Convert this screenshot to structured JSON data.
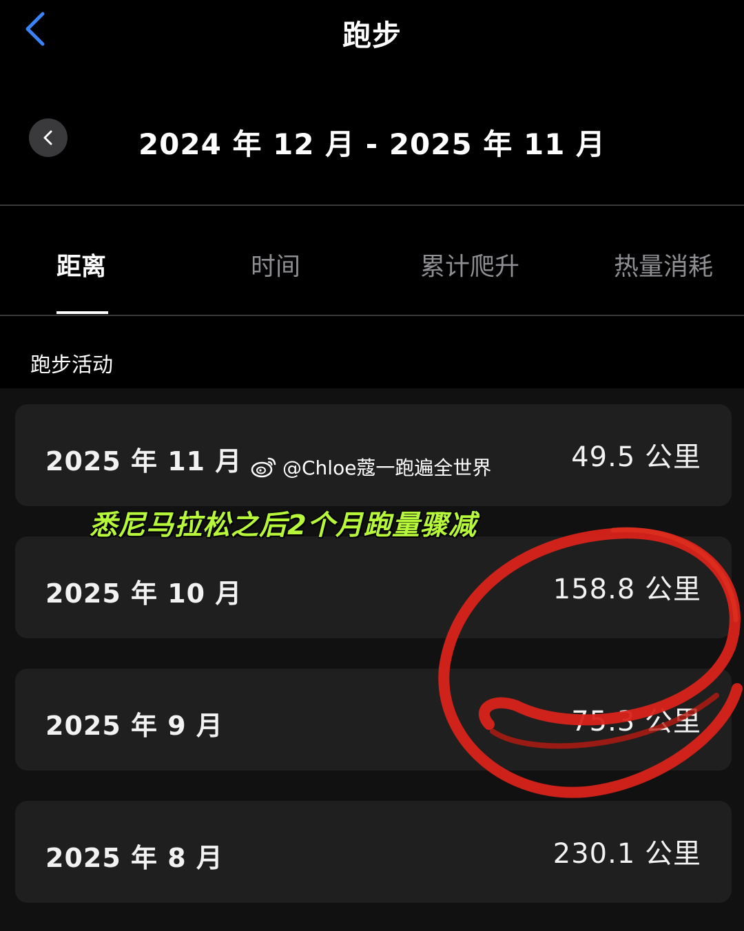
{
  "nav": {
    "title": "跑步"
  },
  "period": {
    "label": "2024 年 12 月  -  2025 年 11 月"
  },
  "tabs": [
    {
      "label": "距离",
      "active": true
    },
    {
      "label": "时间",
      "active": false
    },
    {
      "label": "累计爬升",
      "active": false
    },
    {
      "label": "热量消耗",
      "active": false
    }
  ],
  "section": {
    "title": "跑步活动"
  },
  "activities": [
    {
      "month": "2025 年 11 月",
      "distance": "49.5 公里"
    },
    {
      "month": "2025 年 10 月",
      "distance": "158.8 公里"
    },
    {
      "month": "2025 年 9 月",
      "distance": "75.3 公里"
    },
    {
      "month": "2025 年 8 月",
      "distance": "230.1 公里"
    }
  ],
  "watermark": {
    "text": "@Chloe蔻一跑遍全世界",
    "icon": "weibo-icon"
  },
  "annotation": {
    "text": "悉尼马拉松之后2个月跑量骤减",
    "color": "#b7f93a",
    "circle_color": "#d8231a"
  },
  "colors": {
    "accent": "#3a82f7",
    "background": "#000000",
    "card": "#1f1f1f"
  }
}
